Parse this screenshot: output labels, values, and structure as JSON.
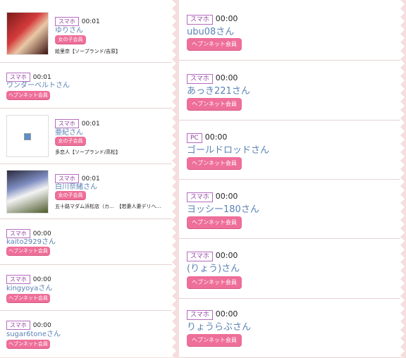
{
  "left": [
    {
      "badge": "スマホ",
      "time": "00:01",
      "name": "ゆりさん",
      "member": "女の子会員",
      "shop": "絵里奈【ソープランド/吉原】",
      "thumb": "photo"
    },
    {
      "badge": "スマホ",
      "time": "00:01",
      "name": "ワンダーベルトさん",
      "member": "ヘブンネット会員"
    },
    {
      "badge": "スマホ",
      "time": "00:01",
      "name": "亜紀さん",
      "member": "女の子会員",
      "shop": "多恋人【ソープランド/高松】",
      "thumb": "placeholder"
    },
    {
      "badge": "スマホ",
      "time": "00:01",
      "name": "白川奈緒さん",
      "member": "女の子会員",
      "shop": "五十路マダム浜松店（カ…　【若妻人妻デリヘ…",
      "thumb": "photo2"
    },
    {
      "badge": "スマホ",
      "time": "00:00",
      "name": "kaito2929さん",
      "member": "ヘブンネット会員"
    },
    {
      "badge": "スマホ",
      "time": "00:00",
      "name": "kingyoyaさん",
      "member": "ヘブンネット会員"
    },
    {
      "badge": "スマホ",
      "time": "00:00",
      "name": "sugar6toneさん",
      "member": "ヘブンネット会員"
    }
  ],
  "right": [
    {
      "badge": "スマホ",
      "time": "00:00",
      "name": "ubu08さん",
      "member": "ヘブンネット会員"
    },
    {
      "badge": "スマホ",
      "time": "00:00",
      "name": "あっき221さん",
      "member": "ヘブンネット会員"
    },
    {
      "badge": "PC",
      "time": "00:00",
      "name": "ゴールドロッドさん",
      "member": "ヘブンネット会員"
    },
    {
      "badge": "スマホ",
      "time": "00:00",
      "name": "ヨッシー180さん",
      "member": "ヘブンネット会員"
    },
    {
      "badge": "スマホ",
      "time": "00:00",
      "name": "(りょう)さん",
      "member": "ヘブンネット会員"
    },
    {
      "badge": "スマホ",
      "time": "00:00",
      "name": "りょうらぶさん",
      "member": "ヘブンネット会員"
    }
  ],
  "colors": {
    "accent": "#ee6f99",
    "name": "#5b83b4",
    "badge": "#8e3e9e",
    "bg": "#f6dede"
  }
}
